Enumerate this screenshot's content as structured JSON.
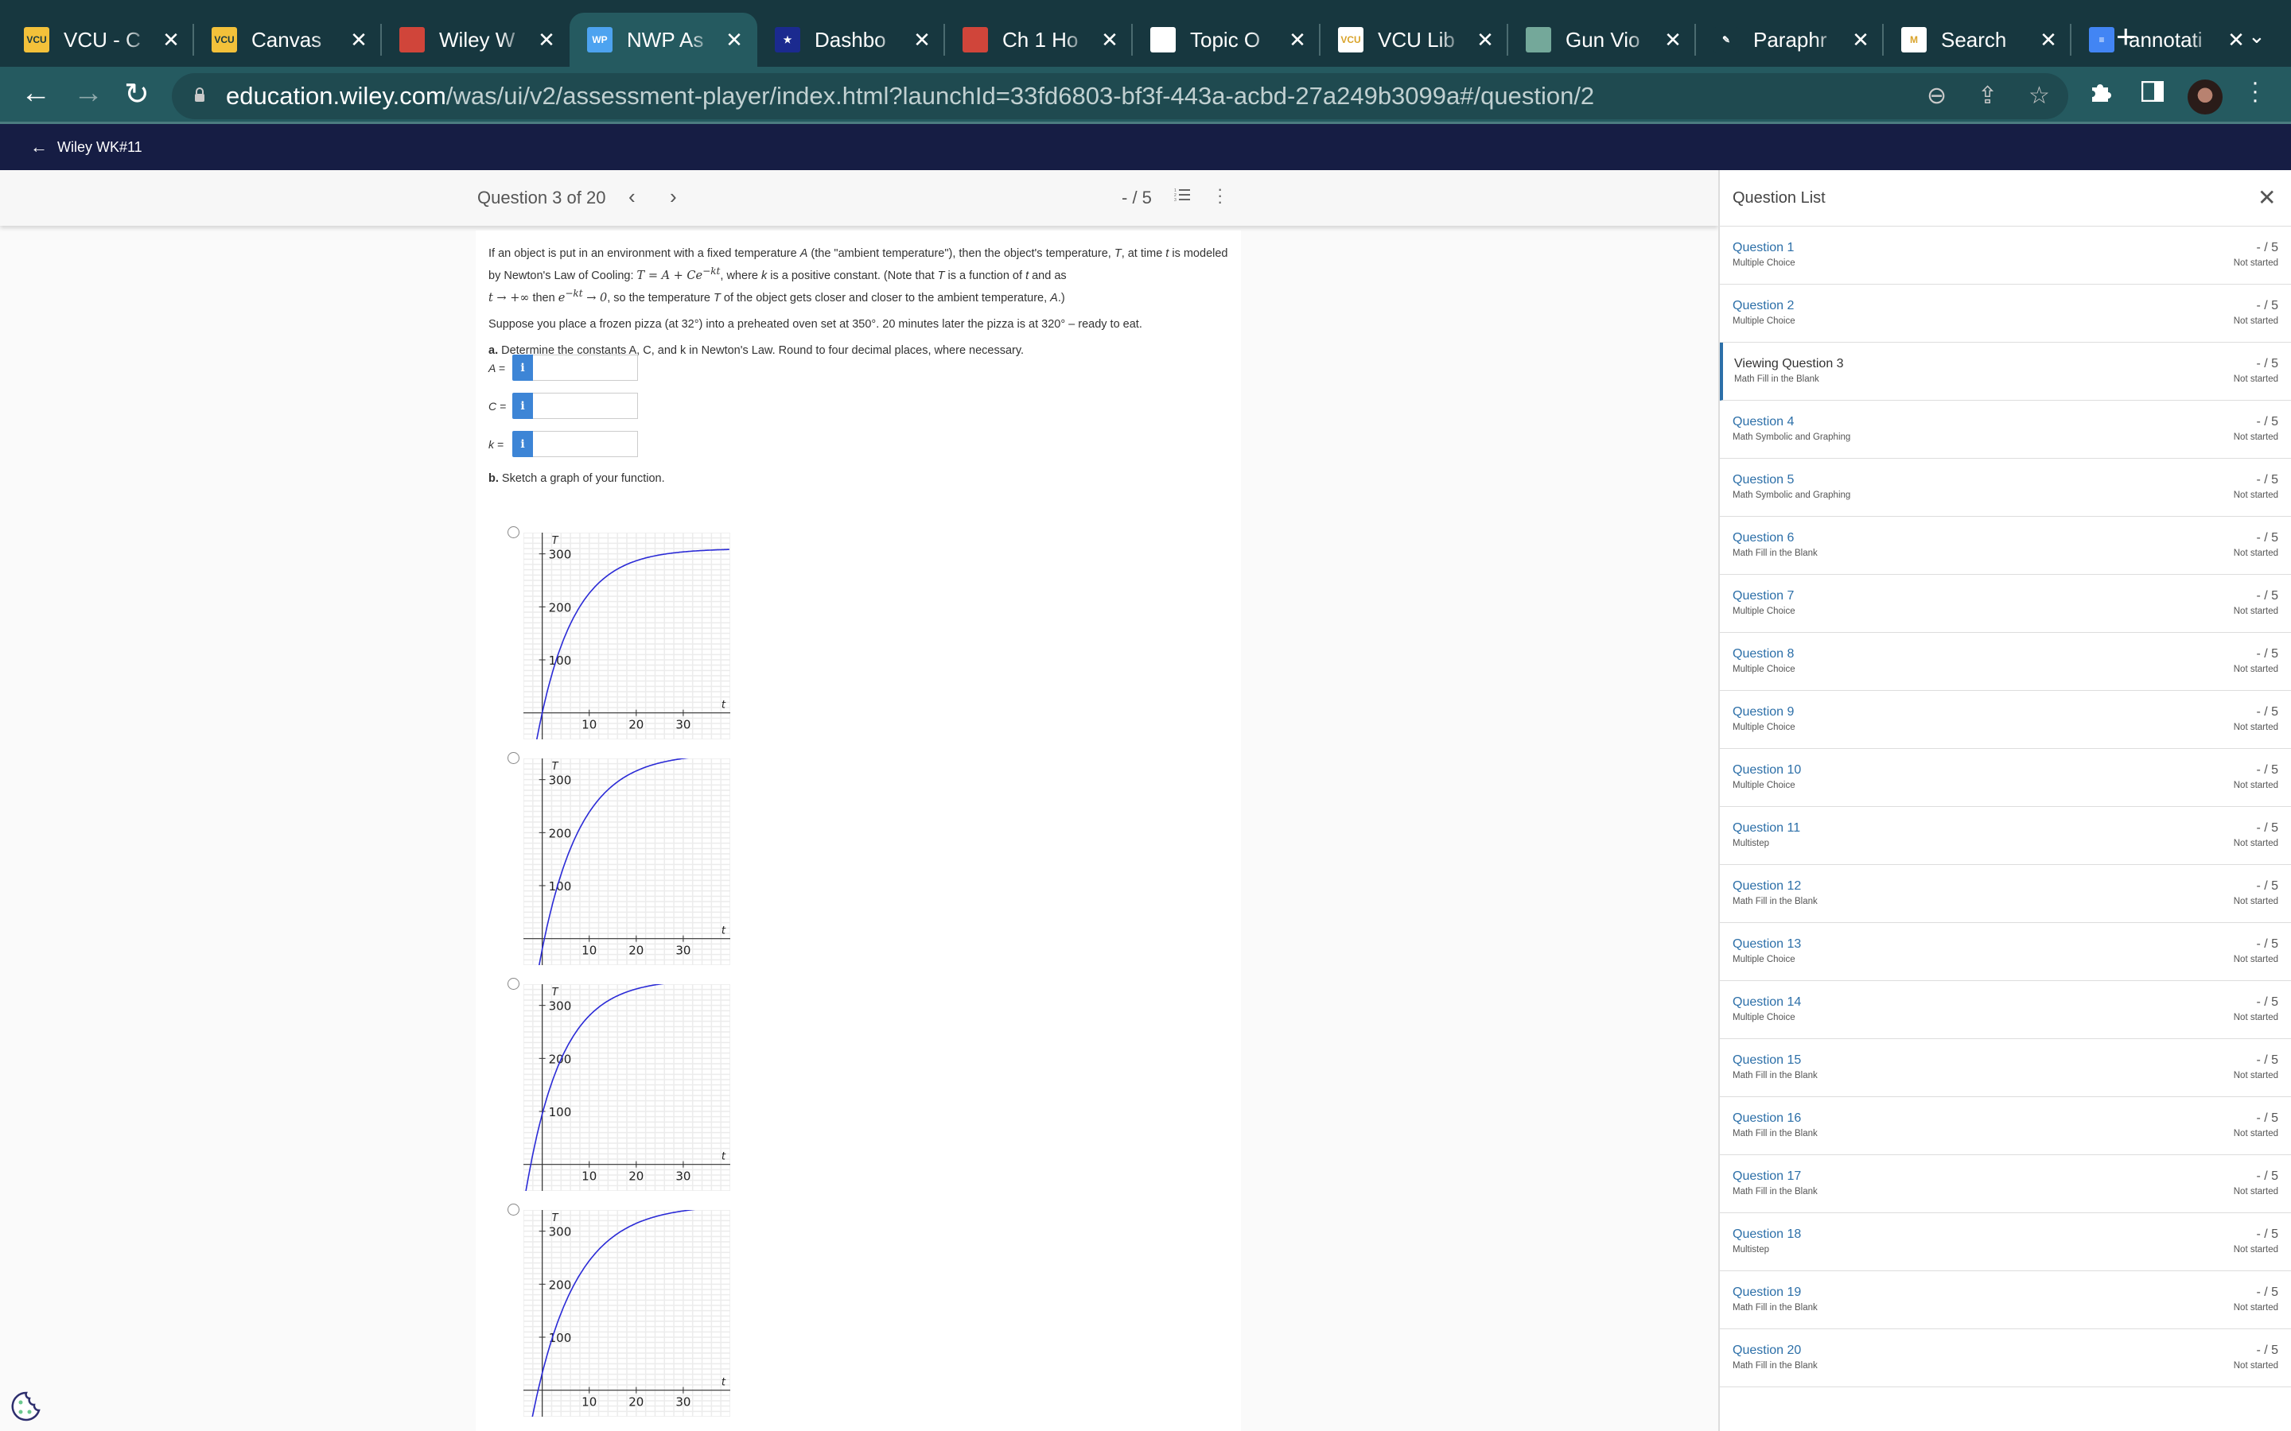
{
  "browser": {
    "tabs": [
      {
        "title": "VCU - C",
        "favicon": "vcu-logo",
        "color": "#f3c13a",
        "text": "VCU",
        "active": false
      },
      {
        "title": "Canvas",
        "favicon": "vcu-logo",
        "color": "#f3c13a",
        "text": "VCU",
        "active": false
      },
      {
        "title": "Wiley W",
        "favicon": "wiley-wheel",
        "color": "#d0453a",
        "text": "",
        "active": false
      },
      {
        "title": "NWP As",
        "favicon": "wp-logo",
        "color": "#4da3f0",
        "text": "WP",
        "active": true
      },
      {
        "title": "Dashbo",
        "favicon": "star-shield",
        "color": "#1b2a8f",
        "text": "★",
        "active": false
      },
      {
        "title": "Ch 1 Ho",
        "favicon": "wiley-wheel",
        "color": "#d0453a",
        "text": "",
        "active": false
      },
      {
        "title": "Topic O",
        "favicon": "globe",
        "color": "#ffffff",
        "text": "",
        "active": false
      },
      {
        "title": "VCU Lib",
        "favicon": "vcu-library",
        "color": "#ffffff",
        "text": "VCU",
        "active": false
      },
      {
        "title": "Gun Vio",
        "favicon": "chatgpt",
        "color": "#74a89a",
        "text": "",
        "active": false
      },
      {
        "title": "Paraphr",
        "favicon": "quill",
        "color": "#17373f",
        "text": "✎",
        "active": false
      },
      {
        "title": "Search",
        "favicon": "gmail",
        "color": "#ffffff",
        "text": "M",
        "active": false
      },
      {
        "title": "annotati",
        "favicon": "google-docs",
        "color": "#4285f4",
        "text": "≡",
        "active": false
      }
    ],
    "new_tab": "+",
    "tab_menu": "⌄",
    "url_host": "education.wiley.com",
    "url_path": "/was/ui/v2/assessment-player/index.html?launchId=33fd6803-bf3f-443a-acbd-27a249b3099a#/question/2"
  },
  "app": {
    "back_label": "Wiley WK#11"
  },
  "question_nav": {
    "counter": "Question 3 of 20",
    "score": "- / 5"
  },
  "question": {
    "intro_1": "If an object is put in an environment with a fixed temperature ",
    "intro_A": "A",
    "intro_2": " (the \"ambient temperature\"), then the object's temperature, ",
    "intro_T": "T",
    "intro_3": ", at time ",
    "intro_t": "t",
    "intro_4": " is modeled by Newton's Law of Cooling: ",
    "formula": "T = A + Ce",
    "formula_exp": "−kt",
    "intro_5": ", where ",
    "intro_k": "k",
    "intro_6": " is a positive constant. (Note that ",
    "intro_T2": "T",
    "intro_7": " is a function of ",
    "intro_t2": "t",
    "intro_8": " and as ",
    "limit_1": "t → +∞",
    "intro_9": " then ",
    "limit_2": "e",
    "limit_2_exp": "−kt",
    "limit_3": " → 0",
    "intro_10": ", so the temperature ",
    "intro_T3": "T",
    "intro_11": " of the object gets closer and closer to the ambient temperature, ",
    "intro_A2": "A",
    "intro_12": ".)",
    "scenario": "Suppose you place a frozen pizza (at 32°) into a preheated oven set at 350°. 20 minutes later the pizza is at 320° – ready to eat.",
    "part_a_label": "a.",
    "part_a_text": " Determine the constants A, C, and k in Newton's Law. Round to four decimal places, where necessary.",
    "fields": [
      {
        "label": "A =",
        "value": "",
        "info": "i"
      },
      {
        "label": "C =",
        "value": "",
        "info": "i"
      },
      {
        "label": "k =",
        "value": "",
        "info": "i"
      }
    ],
    "part_b_label": "b.",
    "part_b_text": " Sketch a graph of your function."
  },
  "chart_data": [
    {
      "type": "line",
      "xlabel": "t",
      "ylabel": "T",
      "xticks": [
        10,
        20,
        30
      ],
      "yticks": [
        100,
        200,
        300
      ],
      "xlim": [
        -4,
        40
      ],
      "ylim": [
        -50,
        340
      ],
      "grid": true,
      "series": [
        {
          "name": "option-1",
          "asymptote": 310,
          "T0": 0,
          "k": 0.13
        }
      ],
      "selected": false
    },
    {
      "type": "line",
      "xlabel": "t",
      "ylabel": "T",
      "xticks": [
        10,
        20,
        30
      ],
      "yticks": [
        100,
        200,
        300
      ],
      "xlim": [
        -4,
        40
      ],
      "ylim": [
        -50,
        340
      ],
      "grid": true,
      "series": [
        {
          "name": "option-2",
          "asymptote": 350,
          "T0": -20,
          "k": 0.12
        }
      ],
      "selected": false
    },
    {
      "type": "line",
      "xlabel": "t",
      "ylabel": "T",
      "xticks": [
        10,
        20,
        30
      ],
      "yticks": [
        100,
        200,
        300
      ],
      "xlim": [
        -4,
        40
      ],
      "ylim": [
        -50,
        340
      ],
      "grid": true,
      "series": [
        {
          "name": "option-3",
          "asymptote": 350,
          "T0": 95,
          "k": 0.13
        }
      ],
      "selected": false
    },
    {
      "type": "line",
      "xlabel": "t",
      "ylabel": "T",
      "xticks": [
        10,
        20,
        30
      ],
      "yticks": [
        100,
        200,
        300
      ],
      "xlim": [
        -4,
        40
      ],
      "ylim": [
        -50,
        340
      ],
      "grid": true,
      "series": [
        {
          "name": "option-4",
          "asymptote": 350,
          "T0": 32,
          "k": 0.11
        }
      ],
      "selected": false
    }
  ],
  "question_list": {
    "title": "Question List",
    "items": [
      {
        "name": "Question 1",
        "type": "Multiple Choice",
        "score": "- / 5",
        "status": "Not started",
        "current": false
      },
      {
        "name": "Question 2",
        "type": "Multiple Choice",
        "score": "- / 5",
        "status": "Not started",
        "current": false
      },
      {
        "name": "Viewing Question 3",
        "type": "Math Fill in the Blank",
        "score": "- / 5",
        "status": "Not started",
        "current": true
      },
      {
        "name": "Question 4",
        "type": "Math Symbolic and Graphing",
        "score": "- / 5",
        "status": "Not started",
        "current": false
      },
      {
        "name": "Question 5",
        "type": "Math Symbolic and Graphing",
        "score": "- / 5",
        "status": "Not started",
        "current": false
      },
      {
        "name": "Question 6",
        "type": "Math Fill in the Blank",
        "score": "- / 5",
        "status": "Not started",
        "current": false
      },
      {
        "name": "Question 7",
        "type": "Multiple Choice",
        "score": "- / 5",
        "status": "Not started",
        "current": false
      },
      {
        "name": "Question 8",
        "type": "Multiple Choice",
        "score": "- / 5",
        "status": "Not started",
        "current": false
      },
      {
        "name": "Question 9",
        "type": "Multiple Choice",
        "score": "- / 5",
        "status": "Not started",
        "current": false
      },
      {
        "name": "Question 10",
        "type": "Multiple Choice",
        "score": "- / 5",
        "status": "Not started",
        "current": false
      },
      {
        "name": "Question 11",
        "type": "Multistep",
        "score": "- / 5",
        "status": "Not started",
        "current": false
      },
      {
        "name": "Question 12",
        "type": "Math Fill in the Blank",
        "score": "- / 5",
        "status": "Not started",
        "current": false
      },
      {
        "name": "Question 13",
        "type": "Multiple Choice",
        "score": "- / 5",
        "status": "Not started",
        "current": false
      },
      {
        "name": "Question 14",
        "type": "Multiple Choice",
        "score": "- / 5",
        "status": "Not started",
        "current": false
      },
      {
        "name": "Question 15",
        "type": "Math Fill in the Blank",
        "score": "- / 5",
        "status": "Not started",
        "current": false
      },
      {
        "name": "Question 16",
        "type": "Math Fill in the Blank",
        "score": "- / 5",
        "status": "Not started",
        "current": false
      },
      {
        "name": "Question 17",
        "type": "Math Fill in the Blank",
        "score": "- / 5",
        "status": "Not started",
        "current": false
      },
      {
        "name": "Question 18",
        "type": "Multistep",
        "score": "- / 5",
        "status": "Not started",
        "current": false
      },
      {
        "name": "Question 19",
        "type": "Math Fill in the Blank",
        "score": "- / 5",
        "status": "Not started",
        "current": false
      },
      {
        "name": "Question 20",
        "type": "Math Fill in the Blank",
        "score": "- / 5",
        "status": "Not started",
        "current": false
      }
    ]
  },
  "colors": {
    "link": "#2c6fa8",
    "info_button": "#3d85d6",
    "curve": "#2a2ad6",
    "app_header": "#161d44",
    "browser_frame": "#17373f"
  }
}
